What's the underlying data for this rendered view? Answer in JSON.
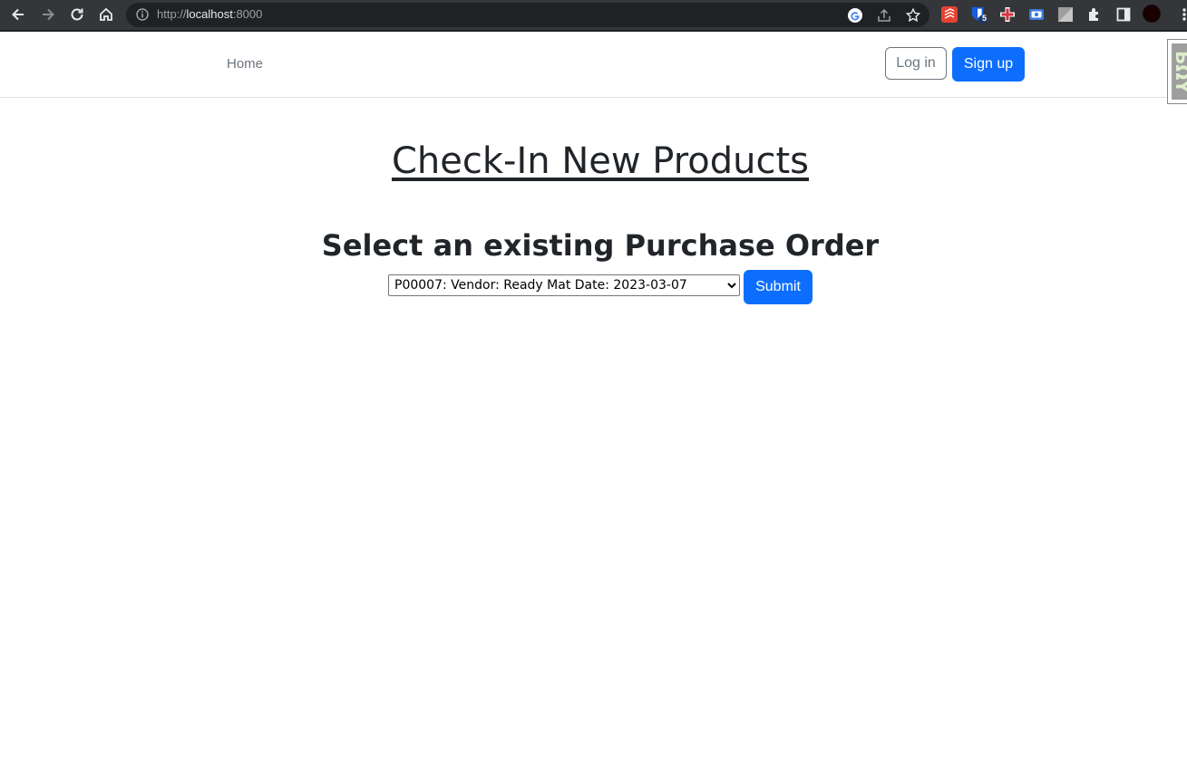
{
  "browser": {
    "url_scheme": "http://",
    "url_host": "localhost",
    "url_port": ":8000",
    "extension_badge": "5",
    "icons": [
      "back-icon",
      "forward-icon",
      "reload-icon",
      "home-icon",
      "info-icon",
      "google-icon",
      "share-icon",
      "bookmark-star-icon",
      "todoist-icon",
      "bitwarden-icon",
      "medical-cross-icon",
      "screen-capture-icon",
      "gray-square-icon",
      "puzzle-icon",
      "side-panel-icon",
      "profile-avatar-icon",
      "menu-icon"
    ]
  },
  "navbar": {
    "home_label": "Home",
    "login_label": "Log in",
    "signup_label": "Sign up",
    "side_widget_text": "БΩΥ"
  },
  "main": {
    "title": "Check-In New Products",
    "section_title": "Select an existing Purchase Order",
    "select": {
      "selected": "P00007: Vendor: Ready Mat Date: 2023-03-07",
      "options": [
        "P00007: Vendor: Ready Mat Date: 2023-03-07"
      ]
    },
    "submit_label": "Submit"
  },
  "colors": {
    "primary": "#0d6efd",
    "secondary": "#6c757d",
    "text": "#212529",
    "chrome_bg": "#35363a"
  }
}
